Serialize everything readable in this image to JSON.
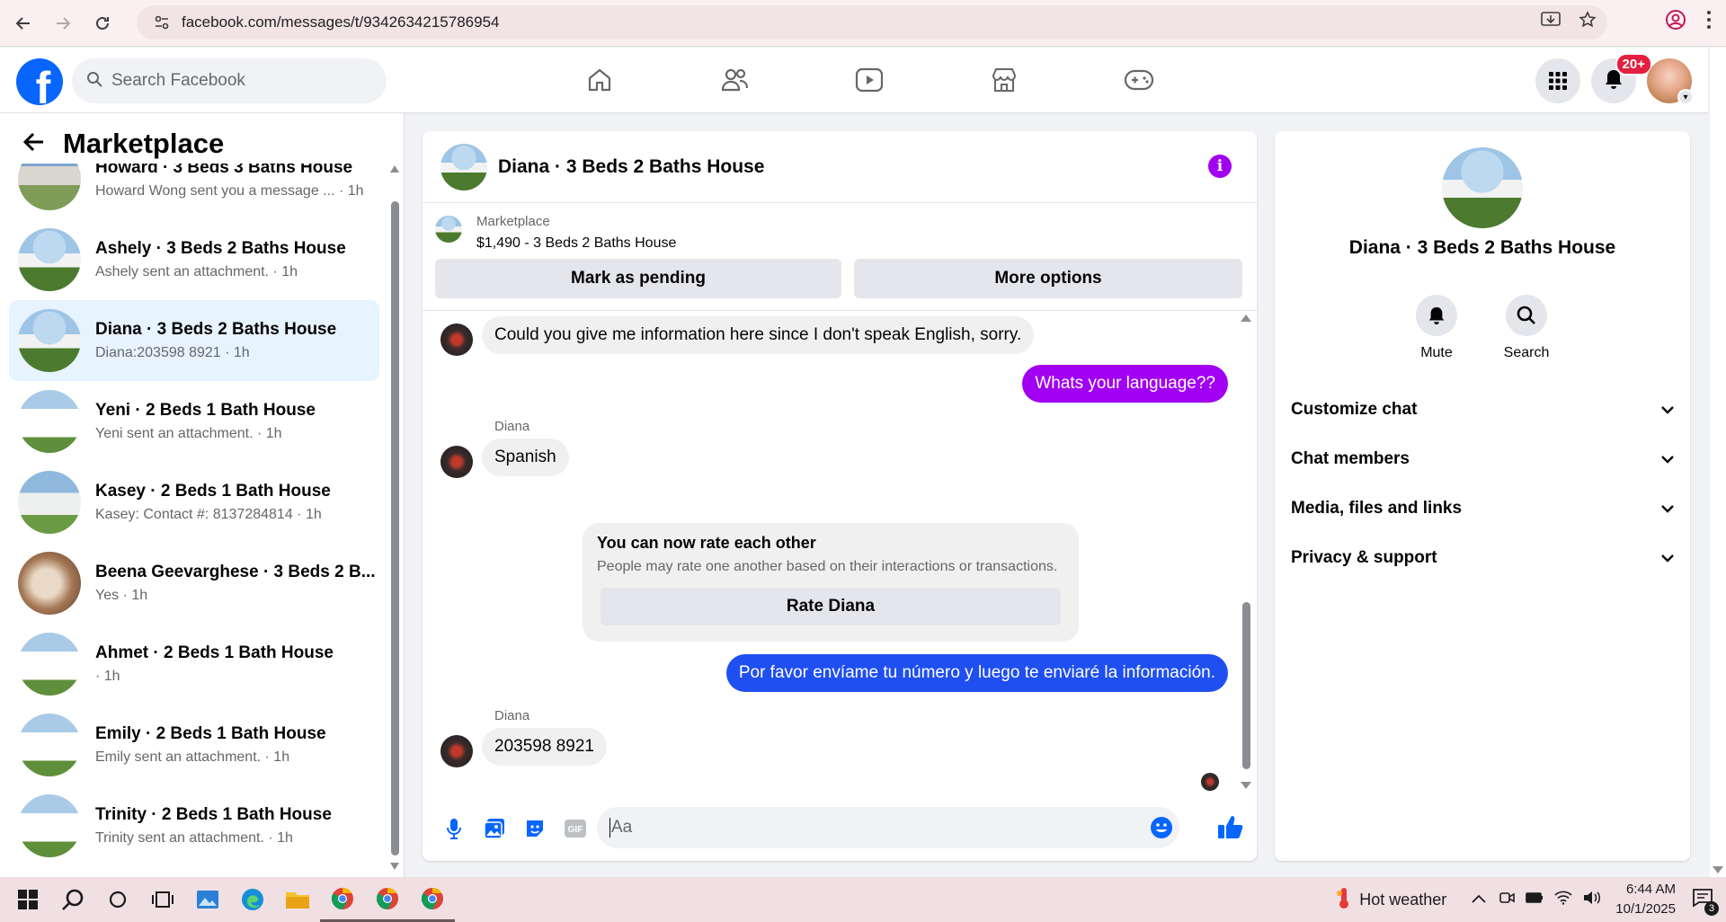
{
  "browser": {
    "url": "facebook.com/messages/t/9342634215786954"
  },
  "header": {
    "search_placeholder": "Search Facebook",
    "notification_badge": "20+"
  },
  "left_panel": {
    "title": "Marketplace",
    "conversations": [
      {
        "name": "Howard · 3 Beds 3 Baths House",
        "sub": "Howard Wong sent you a message ... · 1h"
      },
      {
        "name": "Ashely · 3 Beds 2 Baths House",
        "sub": "Ashely sent an attachment. · 1h"
      },
      {
        "name": "Diana · 3 Beds 2 Baths House",
        "sub": "Diana:203598 8921 · 1h"
      },
      {
        "name": "Yeni · 2 Beds 1 Bath House",
        "sub": "Yeni sent an attachment. · 1h"
      },
      {
        "name": "Kasey · 2 Beds 1 Bath House",
        "sub": "Kasey: Contact #: 8137284814 · 1h"
      },
      {
        "name": "Beena Geevarghese · 3 Beds 2 B...",
        "sub": "Yes · 1h"
      },
      {
        "name": "Ahmet · 2 Beds 1 Bath House",
        "sub": " · 1h"
      },
      {
        "name": "Emily · 2 Beds 1 Bath House",
        "sub": "Emily sent an attachment. · 1h"
      },
      {
        "name": "Trinity · 2 Beds 1 Bath House",
        "sub": "Trinity sent an attachment. · 1h"
      }
    ]
  },
  "chat": {
    "title": "Diana · 3 Beds 2 Baths House",
    "listing_source": "Marketplace",
    "listing_price": "$1,490 - 3 Beds 2 Baths House",
    "mark_pending_label": "Mark as pending",
    "more_options_label": "More options",
    "messages": {
      "m1": "Could you give me information here since I don't speak English, sorry.",
      "m2": "Whats your language??",
      "m3_sender": "Diana",
      "m3": "Spanish",
      "m4": "Por favor envíame tu número y luego te enviaré la información.",
      "m5_sender": "Diana",
      "m5": "203598 8921"
    },
    "rate_card": {
      "title": "You can now rate each other",
      "subtitle": "People may rate one another based on their interactions or transactions.",
      "button": "Rate Diana"
    },
    "composer_placeholder": "Aa"
  },
  "right_panel": {
    "name": "Diana · 3 Beds 2 Baths House",
    "mute_label": "Mute",
    "search_label": "Search",
    "sections": [
      "Customize chat",
      "Chat members",
      "Media, files and links",
      "Privacy & support"
    ]
  },
  "taskbar": {
    "weather": "Hot weather",
    "time": "6:44 AM",
    "date": "10/1/2025",
    "notification_count": "3"
  },
  "colors": {
    "fb_blue": "#0866ff",
    "outgoing_purple": "#a100f2",
    "outgoing_blue": "#1f4ff0",
    "active_item": "#e7f3ff"
  }
}
